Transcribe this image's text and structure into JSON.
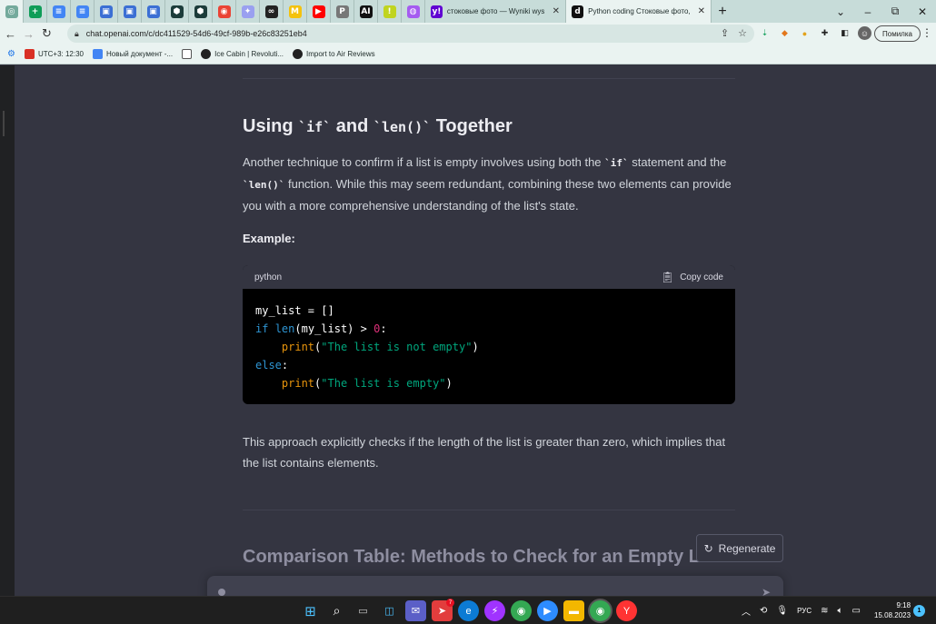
{
  "browser": {
    "tabs": [
      {
        "title": "стоковые фото — Wyniki wyszu",
        "close": "✕"
      },
      {
        "title": "Python coding Стоковые фото, в",
        "close": "✕"
      }
    ],
    "new_tab": "+",
    "window_controls": {
      "min": "–",
      "restore": "⧉",
      "close": "✕"
    },
    "url": "chat.openai.com/c/dc411529-54d6-49cf-989b-e26c83251eb4",
    "profile_button": "Помилка",
    "bookmarks": [
      {
        "label": "UTC+3: 12:30",
        "color": "#d93025"
      },
      {
        "label": "Новый документ -...",
        "color": "#4285f4"
      },
      {
        "label": "",
        "color": "#555555"
      },
      {
        "label": "Ice Cabin | Revoluti...",
        "color": "#222222"
      },
      {
        "label": "Import to Air Reviews",
        "color": "#222222"
      }
    ]
  },
  "article": {
    "heading_pre": "Using ",
    "heading_code1": "`if`",
    "heading_mid": " and ",
    "heading_code2": "`len()`",
    "heading_post": " Together",
    "para1_a": "Another technique to confirm if a list is empty involves using both the ",
    "para1_code1": "`if`",
    "para1_b": " statement and the ",
    "para1_code2": "`len()`",
    "para1_c": " function. While this may seem redundant, combining these two elements can provide you with a more comprehensive understanding of the list's state.",
    "example_label": "Example:",
    "code_lang": "python",
    "copy_label": "Copy code",
    "code_lines": {
      "l1": "my_list = []",
      "l2_kw": "if",
      "l2_fn": "len",
      "l2_args": "(my_list) > ",
      "l2_num": "0",
      "l2_end": ":",
      "l3_fn": "print",
      "l3_str": "\"The list is not empty\"",
      "l4_kw": "else",
      "l4_end": ":",
      "l5_fn": "print",
      "l5_str": "\"The list is empty\""
    },
    "para2": "This approach explicitly checks if the length of the list is greater than zero, which implies that the list contains elements.",
    "next_heading": "Comparison Table: Methods to Check for an Empty List",
    "regenerate_label": "Regenerate"
  },
  "taskbar": {
    "badge_count": "7",
    "lang": "РУС",
    "time": "9:18",
    "date": "15.08.2023",
    "notifications": "1"
  }
}
